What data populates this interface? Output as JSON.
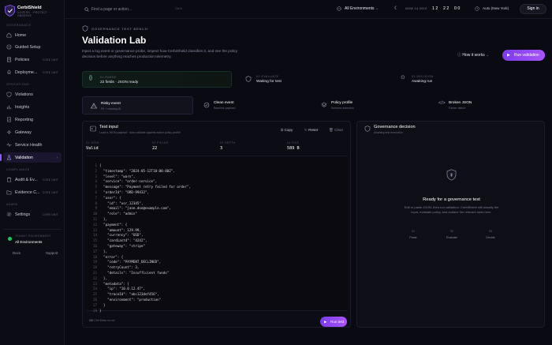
{
  "brand": {
    "name": "CerbiShield",
    "subtitle": "GOVERN · PROTECT · OBSERVE"
  },
  "sidebar": {
    "sections": {
      "governance": "GOVERNANCE",
      "operations": "OPERATIONS",
      "compliance": "COMPLIANCE",
      "admin": "ADMIN"
    },
    "items": [
      {
        "label": "Home"
      },
      {
        "label": "Guided Setup"
      },
      {
        "label": "Policies",
        "badge": "CORE UNIT"
      },
      {
        "label": "Deployme...",
        "badge": "CORE UNIT"
      },
      {
        "label": "Violations"
      },
      {
        "label": "Insights"
      },
      {
        "label": "Reporting"
      },
      {
        "label": "Gateway"
      },
      {
        "label": "Service Health"
      },
      {
        "label": "Validation"
      },
      {
        "label": "Audit & Ev...",
        "badge": "CORE UNIT"
      },
      {
        "label": "Evidence C...",
        "badge": "CORE UNIT"
      },
      {
        "label": "Settings",
        "badge": "CORE UNIT"
      }
    ],
    "tenant": {
      "label": "TENANT ENVIRONMENT",
      "value": "All Environments"
    },
    "footer": {
      "docs": "Docs",
      "support": "Support"
    }
  },
  "topbar": {
    "search_placeholder": "Find a page or action...",
    "search_shortcut": "Ctrl K",
    "environment": "All Environments",
    "stats": [
      {
        "label": "NOW 14 2010",
        "value": "1 2"
      },
      {
        "label": "",
        "value": "2 2"
      },
      {
        "label": "",
        "value": "0 0"
      }
    ],
    "timezone": "Auto (New York)",
    "signin": "Sign in"
  },
  "header": {
    "eyebrow": "GOVERNANCE TEST BENCH",
    "title": "Validation Lab",
    "description": "Inject a log event or governance probe, inspect how CerbiShield classifies it, and see the policy decision before anything reaches production telemetry.",
    "how_it_works": "How it works",
    "run": "Run validation"
  },
  "status_cards": [
    {
      "key": "01 PARSE",
      "value": "22 fields · JSON ready"
    },
    {
      "key": "02 EVALUATE",
      "value": "Waiting for test"
    },
    {
      "key": "03 DECISION",
      "value": "Awaiting run"
    }
  ],
  "presets": [
    {
      "title": "Risky event",
      "sub": "PII + missing ID"
    },
    {
      "title": "Clean event",
      "sub": "Baseline payload"
    },
    {
      "title": "Policy profile",
      "sub": "Schema detection"
    },
    {
      "title": "Broken JSON",
      "sub": "Parser failure"
    }
  ],
  "test_input": {
    "title": "Test input",
    "subtitle": "Load a JSON payload · auto-validate against active policy profile",
    "actions": {
      "copy": "Copy",
      "reset": "Reset",
      "clear": "Clear"
    },
    "stats": [
      {
        "key": "01 JSON",
        "value": "Valid"
      },
      {
        "key": "02 FIELDS",
        "value": "22"
      },
      {
        "key": "03 DEPTH",
        "value": "3"
      },
      {
        "key": "04 SIZE",
        "value": "589 B"
      }
    ],
    "code_lines": [
      "{",
      "  \"timestamp\": \"2024-05-12T10:00:00Z\",",
      "  \"level\": \"warn\",",
      "  \"service\": \"order-service\",",
      "  \"message\": \"Payment retry failed for order\",",
      "  \"orderId\": \"ORD-99432\",",
      "  \"user\": {",
      "    \"id\": \"usr_12345\",",
      "    \"email\": \"jane.doe@example.com\",",
      "    \"role\": \"admin\"",
      "  },",
      "  \"payment\": {",
      "    \"amount\": 129.99,",
      "    \"currency\": \"USD\",",
      "    \"cardLast4\": \"4242\",",
      "    \"gateway\": \"stripe\"",
      "  },",
      "  \"error\": {",
      "    \"code\": \"PAYMENT_DECLINED\",",
      "    \"retryCount\": 3,",
      "    \"details\": \"Insufficient funds\"",
      "  },",
      "  \"metadata\": {",
      "    \"ip\": \"10.0.12.47\",",
      "    \"traceId\": \"abc123def456\",",
      "    \"environment\": \"production\"",
      "  }",
      "}"
    ],
    "hint": "Ctrl+Enter to run",
    "run": "Run test"
  },
  "governance_decision": {
    "title": "Governance decision",
    "subtitle": "Awaiting test execution",
    "empty_title": "Ready for a governance test",
    "empty_desc": "Edit or paste JSON, then run validation. CerbiShield will classify the input, evaluate policy, and surface the relevant rules here.",
    "steps": [
      {
        "num": "01",
        "label": "Parse"
      },
      {
        "num": "02",
        "label": "Evaluate"
      },
      {
        "num": "03",
        "label": "Decide"
      }
    ]
  },
  "colors": {
    "accent": "#8b5cf6",
    "ready": "#22c55e",
    "bg": "#0a0a12"
  }
}
